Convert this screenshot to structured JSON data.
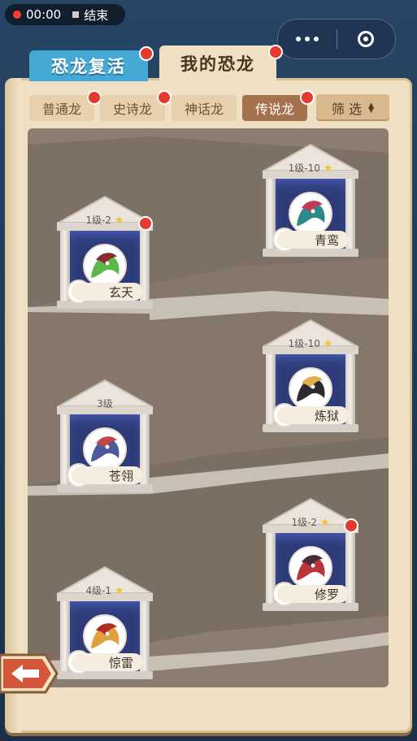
{
  "status": {
    "time": "00:00",
    "end_label": "结束"
  },
  "tabs": {
    "revive": "恐龙复活",
    "mine": "我的恐龙"
  },
  "subtabs": [
    "普通龙",
    "史诗龙",
    "神话龙",
    "传说龙"
  ],
  "filter_label": "筛 选",
  "dragons": [
    {
      "name": "青鸾",
      "level": "1级-10",
      "star": true,
      "colors": [
        "#2c8a86",
        "#c23a5a"
      ]
    },
    {
      "name": "玄天",
      "level": "1级-2",
      "star": true,
      "colors": [
        "#5db84a",
        "#8a2c2c"
      ]
    },
    {
      "name": "炼狱",
      "level": "1级-10",
      "star": true,
      "colors": [
        "#2a2a30",
        "#e0b04a"
      ]
    },
    {
      "name": "苍翎",
      "level": "3级",
      "star": false,
      "colors": [
        "#4b5a9c",
        "#c0484a"
      ]
    },
    {
      "name": "修罗",
      "level": "1级-2",
      "star": true,
      "colors": [
        "#b8353a",
        "#4a2a34"
      ]
    },
    {
      "name": "惊雷",
      "level": "4级-1",
      "star": true,
      "colors": [
        "#e0a040",
        "#b02c20"
      ]
    }
  ]
}
